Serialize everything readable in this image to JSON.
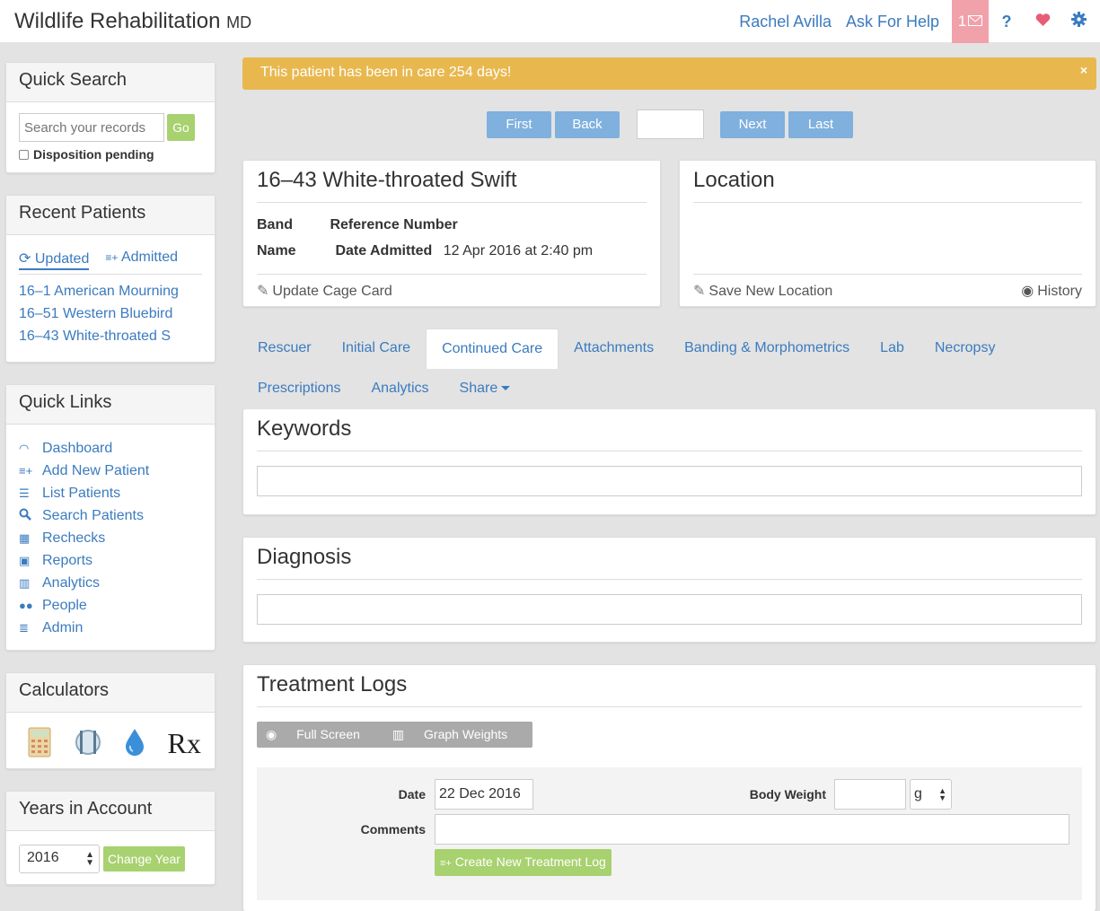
{
  "brand": {
    "title": "Wildlife Rehabilitation",
    "suffix": "MD"
  },
  "nav": {
    "user": "Rachel Avilla",
    "help": "Ask For Help",
    "messages_count": "1",
    "question": "?"
  },
  "quick_search": {
    "title": "Quick Search",
    "placeholder": "Search your records",
    "go": "Go",
    "checkbox_label": "Disposition pending"
  },
  "recent": {
    "title": "Recent Patients",
    "tab_updated": "Updated",
    "tab_admitted": "Admitted",
    "items": [
      "16–1 American Mourning",
      "16–51 Western Bluebird",
      "16–43 White-throated S"
    ]
  },
  "quick_links": {
    "title": "Quick Links",
    "items": [
      "Dashboard",
      "Add New Patient",
      "List Patients",
      "Search Patients",
      "Rechecks",
      "Reports",
      "Analytics",
      "People",
      "Admin"
    ]
  },
  "calculators": {
    "title": "Calculators",
    "rx": "Rx"
  },
  "years": {
    "title": "Years in Account",
    "selected": "2016",
    "button": "Change Year"
  },
  "alert": {
    "text": "This patient has been in care 254 days!",
    "close": "×"
  },
  "pager": {
    "first": "First",
    "back": "Back",
    "next": "Next",
    "last": "Last"
  },
  "patient": {
    "title": "16–43 White-throated Swift",
    "band_label": "Band",
    "reference_label": "Reference Number",
    "name_label": "Name",
    "date_label": "Date Admitted",
    "date_value": "12 Apr 2016 at 2:40 pm",
    "update_cage": "Update Cage Card"
  },
  "location": {
    "title": "Location",
    "save": "Save New Location",
    "history": "History"
  },
  "tabs": [
    "Rescuer",
    "Initial Care",
    "Continued Care",
    "Attachments",
    "Banding & Morphometrics",
    "Lab",
    "Necropsy"
  ],
  "tabs2": [
    "Prescriptions",
    "Analytics",
    "Share"
  ],
  "keywords": {
    "title": "Keywords"
  },
  "diagnosis": {
    "title": "Diagnosis"
  },
  "treatment": {
    "title": "Treatment Logs",
    "full_screen": "Full Screen",
    "graph_weights": "Graph Weights",
    "date_label": "Date",
    "date_value": "22 Dec 2016",
    "weight_label": "Body Weight",
    "unit": "g",
    "comments_label": "Comments",
    "create": "Create New Treatment Log"
  },
  "colors": {
    "accent": "#3b7bbf",
    "alert": "#e8b84f",
    "green": "#a8d16f",
    "pager": "#7fb0de",
    "badge": "#f0a1aa"
  }
}
